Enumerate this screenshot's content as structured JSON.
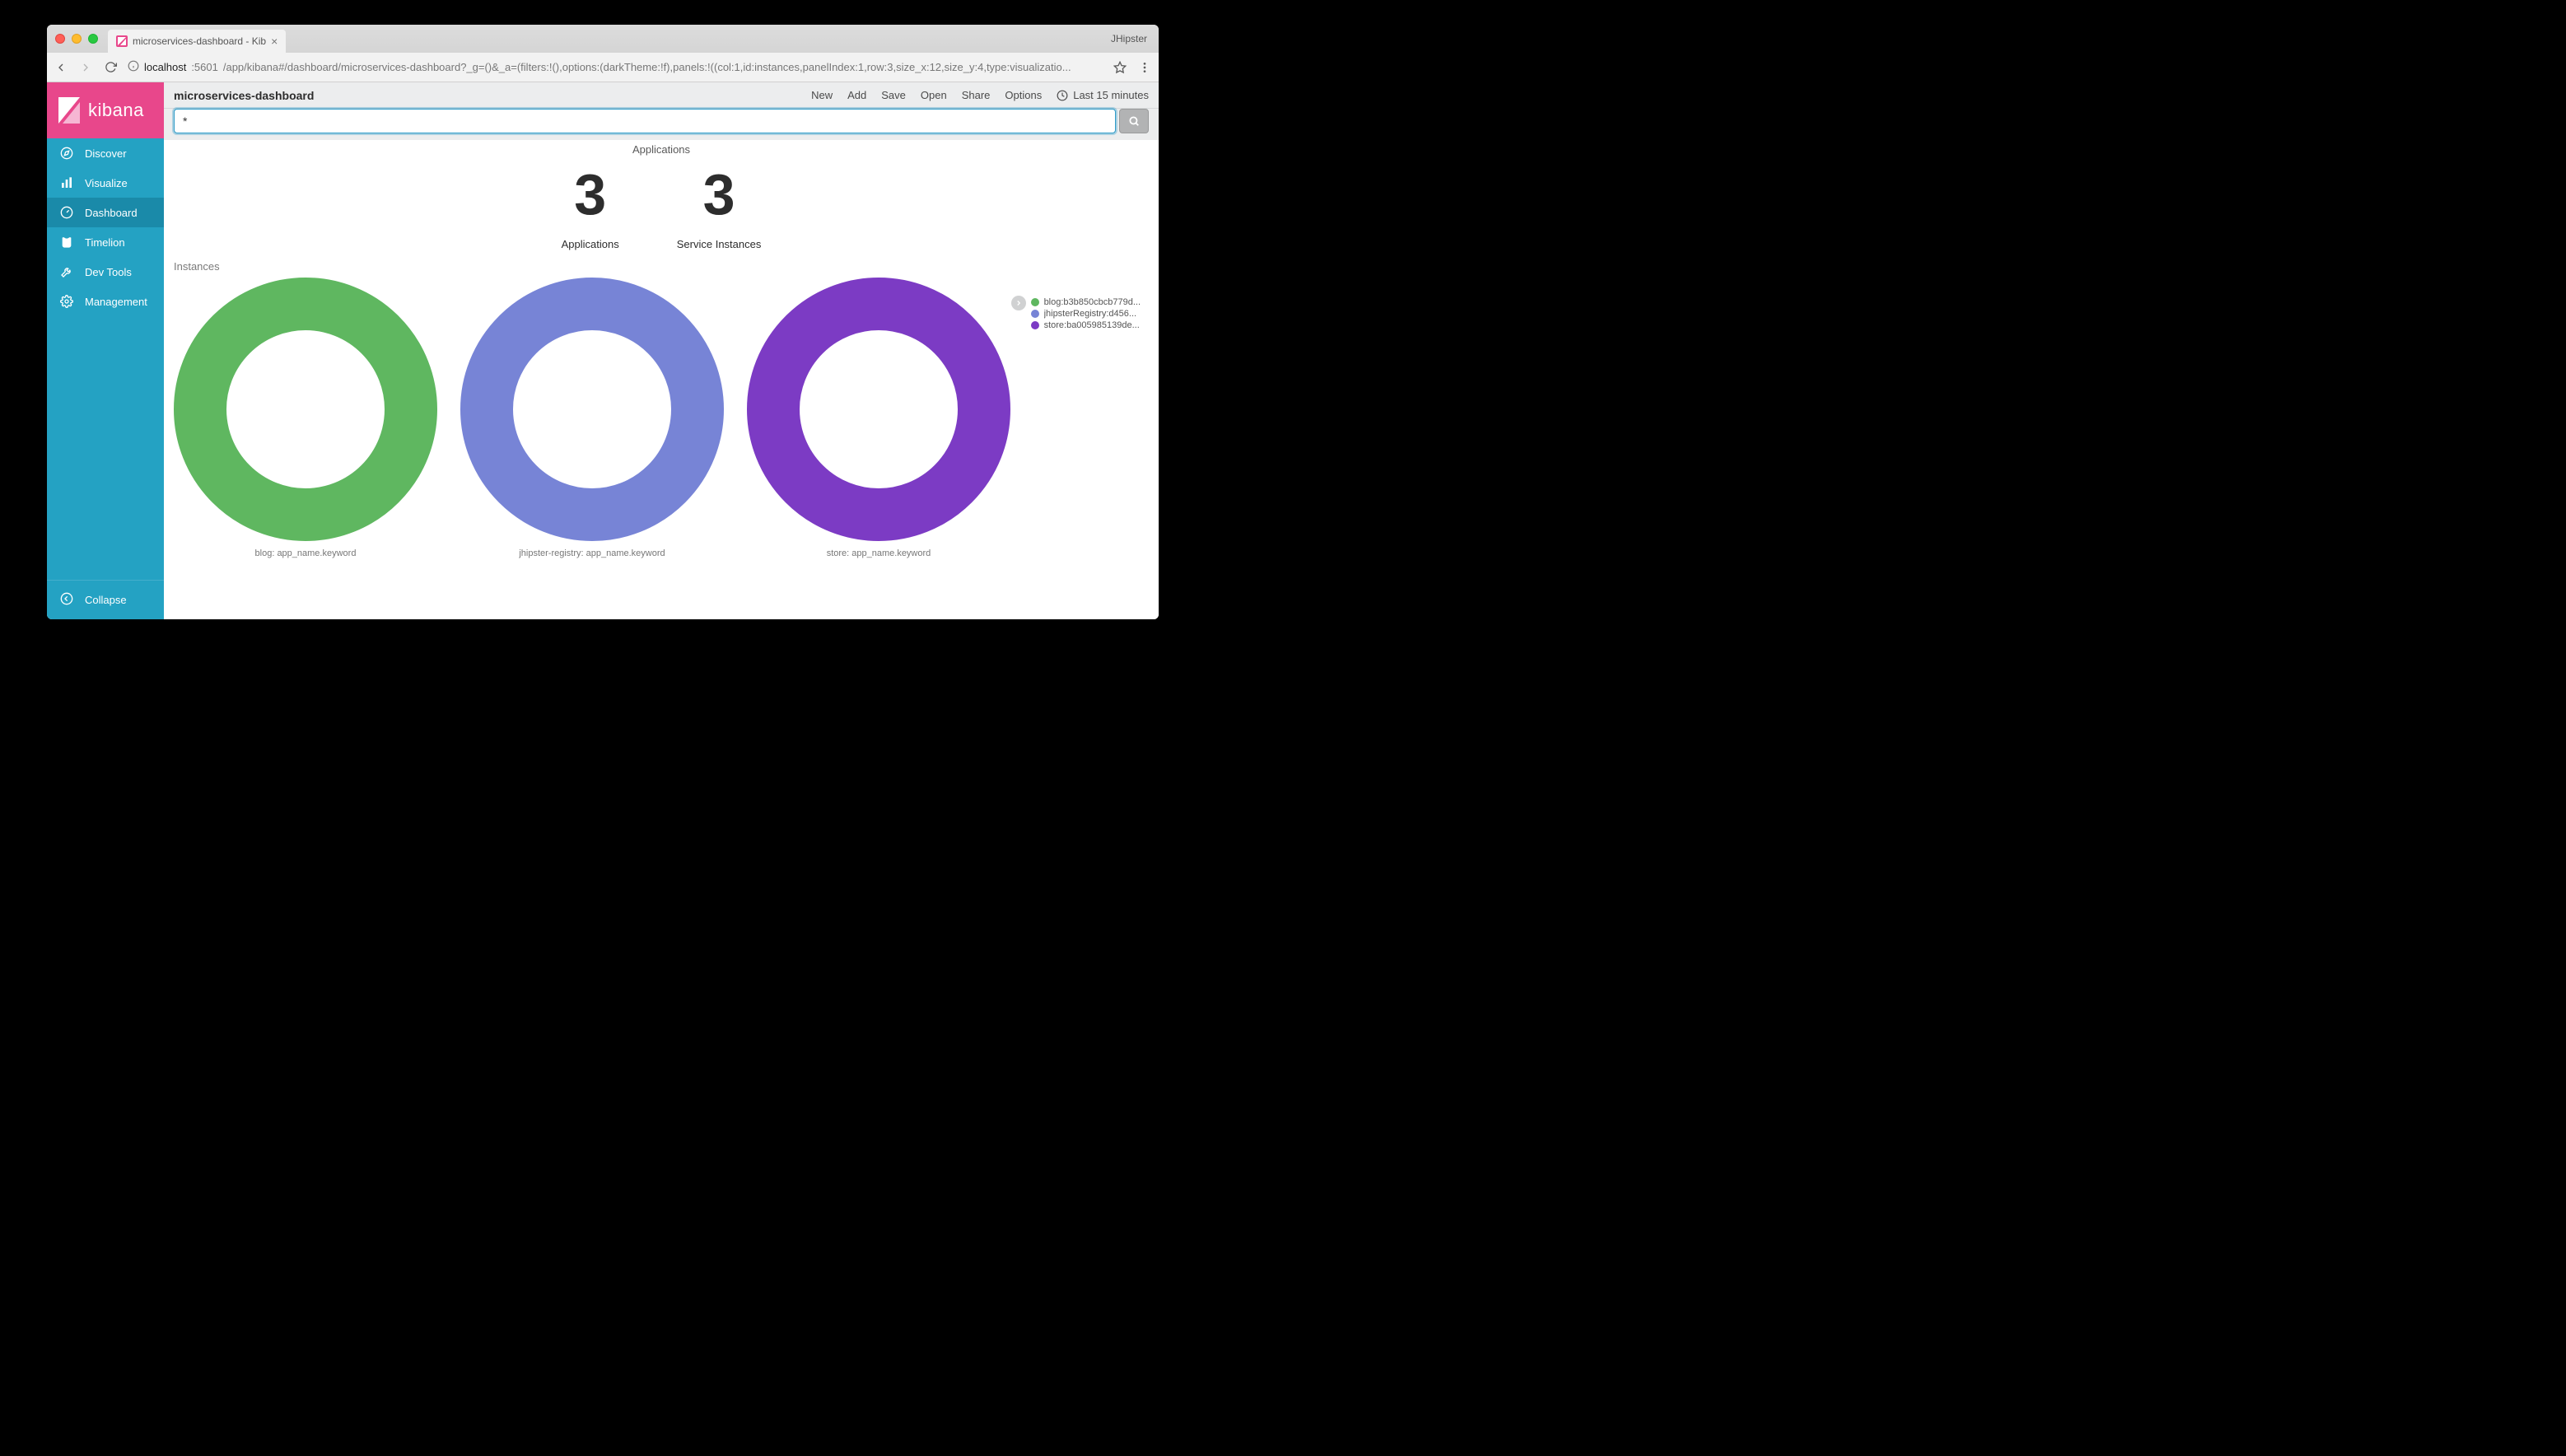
{
  "browser": {
    "tab_title": "microservices-dashboard - Kib",
    "profile": "JHipster",
    "url_host": "localhost",
    "url_port": ":5601",
    "url_path": "/app/kibana#/dashboard/microservices-dashboard?_g=()&_a=(filters:!(),options:(darkTheme:!f),panels:!((col:1,id:instances,panelIndex:1,row:3,size_x:12,size_y:4,type:visualizatio..."
  },
  "sidebar": {
    "brand": "kibana",
    "items": [
      {
        "label": "Discover"
      },
      {
        "label": "Visualize"
      },
      {
        "label": "Dashboard"
      },
      {
        "label": "Timelion"
      },
      {
        "label": "Dev Tools"
      },
      {
        "label": "Management"
      }
    ],
    "collapse": "Collapse"
  },
  "topbar": {
    "dashboard_name": "microservices-dashboard",
    "links": {
      "new": "New",
      "add": "Add",
      "save": "Save",
      "open": "Open",
      "share": "Share",
      "options": "Options"
    },
    "time_label": "Last 15 minutes"
  },
  "query": {
    "value": "*"
  },
  "applications_panel": {
    "title": "Applications",
    "metrics": [
      {
        "value": "3",
        "label": "Applications"
      },
      {
        "value": "3",
        "label": "Service Instances"
      }
    ]
  },
  "instances_panel": {
    "title": "Instances",
    "legend": [
      {
        "color": "#5fb760",
        "label": "blog:b3b850cbcb779d..."
      },
      {
        "color": "#7784d6",
        "label": "jhipsterRegistry:d456..."
      },
      {
        "color": "#7c3bc4",
        "label": "store:ba005985139de..."
      }
    ],
    "donuts": [
      {
        "color": "#5fb760",
        "caption": "blog: app_name.keyword"
      },
      {
        "color": "#7784d6",
        "caption": "jhipster-registry: app_name.keyword"
      },
      {
        "color": "#7c3bc4",
        "caption": "store: app_name.keyword"
      }
    ]
  },
  "chart_data": [
    {
      "type": "pie",
      "title": "blog",
      "series": [
        {
          "name": "blog:b3b850cbcb779d...",
          "value": 1
        }
      ]
    },
    {
      "type": "pie",
      "title": "jhipster-registry",
      "series": [
        {
          "name": "jhipsterRegistry:d456...",
          "value": 1
        }
      ]
    },
    {
      "type": "pie",
      "title": "store",
      "series": [
        {
          "name": "store:ba005985139de...",
          "value": 1
        }
      ]
    }
  ]
}
